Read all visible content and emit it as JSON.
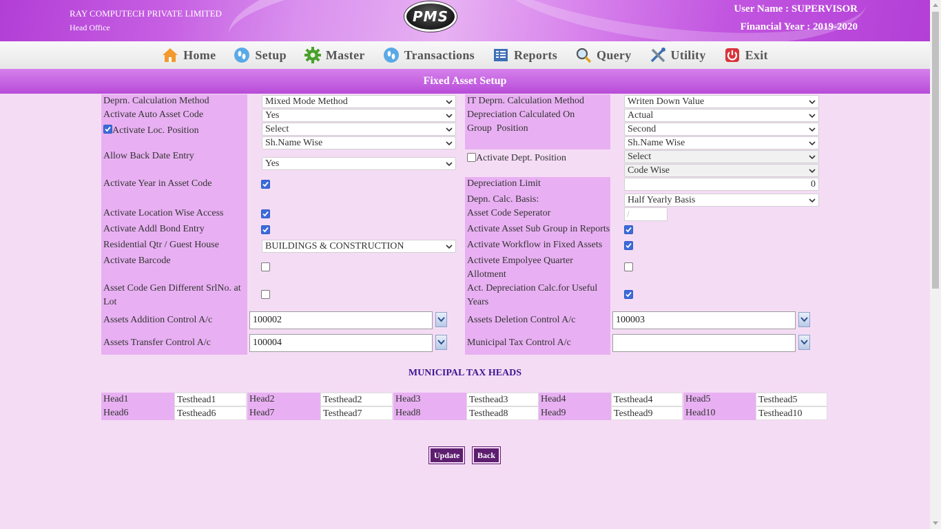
{
  "header": {
    "company": "RAY COMPUTECH PRIVATE LIMITED",
    "office": "Head Office",
    "logo_text": "PMS",
    "user": "User Name : SUPERVISOR",
    "financial_year": "Financial Year : 2019-2020"
  },
  "nav": {
    "home": "Home",
    "setup": "Setup",
    "master": "Master",
    "transactions": "Transactions",
    "reports": "Reports",
    "query": "Query",
    "utility": "Utility",
    "exit": "Exit"
  },
  "page_title": "Fixed Asset Setup",
  "left": {
    "depr_method_label": "Deprn. Calculation Method",
    "depr_method_value": "Mixed Mode Method",
    "auto_code_label": "Activate Auto Asset Code",
    "auto_code_value": "Yes",
    "loc_position_label": "Activate Loc. Position",
    "loc_position_checked": true,
    "loc_position_value1": "Select",
    "loc_position_value2": "Sh.Name Wise",
    "back_date_label": "Allow Back Date Entry",
    "back_date_value": "Yes",
    "year_in_code_label": "Activate Year in Asset Code",
    "year_in_code_checked": true,
    "loc_wise_access_label": "Activate Location Wise Access",
    "loc_wise_access_checked": true,
    "addl_bond_label": "Activate Addl Bond Entry",
    "addl_bond_checked": true,
    "residential_label": "Residential Qtr / Guest House",
    "residential_value": "BUILDINGS & CONSTRUCTION",
    "barcode_label": "Activate Barcode",
    "barcode_checked": false,
    "code_gen_label": "Asset Code Gen Different SrlNo. at Lot",
    "code_gen_checked": false,
    "addition_ac_label": "Assets Addition Control A/c",
    "addition_ac_value": "100002",
    "transfer_ac_label": "Assets Transfer Control A/c",
    "transfer_ac_value": "100004"
  },
  "right": {
    "it_depr_label": "IT Deprn. Calculation Method",
    "it_depr_value": "Writen Down Value",
    "depr_on_label": "Depreciation Calculated On",
    "depr_on_value": "Actual",
    "group_position_label": "Group  Position",
    "group_position_value1": "Second",
    "group_position_value2": "Sh.Name Wise",
    "dept_position_label": "Activate Dept. Position",
    "dept_position_checked": false,
    "dept_position_value1": "Select",
    "dept_position_value2": "Code Wise",
    "depr_limit_label": "Depreciation Limit",
    "depr_limit_value": "0",
    "calc_basis_label": "Depn. Calc. Basis:",
    "calc_basis_value": "Half Yearly Basis",
    "separator_label": "Asset Code Seperator",
    "separator_value": "/",
    "sub_group_label": "Activate Asset Sub Group in Reports",
    "sub_group_checked": true,
    "workflow_label": "Activate Workflow in Fixed Assets",
    "workflow_checked": true,
    "quarter_label": "Activete Empolyee Quarter Allotment",
    "quarter_checked": false,
    "useful_years_label": "Act. Depreciation Calc.for Useful Years",
    "useful_years_checked": true,
    "deletion_ac_label": "Assets Deletion Control A/c",
    "deletion_ac_value": "100003",
    "municipal_ac_label": "Municipal Tax Control A/c",
    "municipal_ac_value": ""
  },
  "municipal": {
    "heading": "MUNICIPAL TAX HEADS",
    "heads": [
      {
        "label": "Head1",
        "value": "Testhead1"
      },
      {
        "label": "Head2",
        "value": "Testhead2"
      },
      {
        "label": "Head3",
        "value": "Testhead3"
      },
      {
        "label": "Head4",
        "value": "Testhead4"
      },
      {
        "label": "Head5",
        "value": "Testhead5"
      },
      {
        "label": "Head6",
        "value": "Testhead6"
      },
      {
        "label": "Head7",
        "value": "Testhead7"
      },
      {
        "label": "Head8",
        "value": "Testhead8"
      },
      {
        "label": "Head9",
        "value": "Testhead9"
      },
      {
        "label": "Head10",
        "value": "Testhead10"
      }
    ]
  },
  "buttons": {
    "update": "Update",
    "back": "Back"
  },
  "colors": {
    "header_purple": "#b83fd8",
    "label_bg": "#e8b0f2",
    "page_bg": "#f5dcf5",
    "button": "#5d1e70",
    "checkbox": "#3c6bd8"
  }
}
